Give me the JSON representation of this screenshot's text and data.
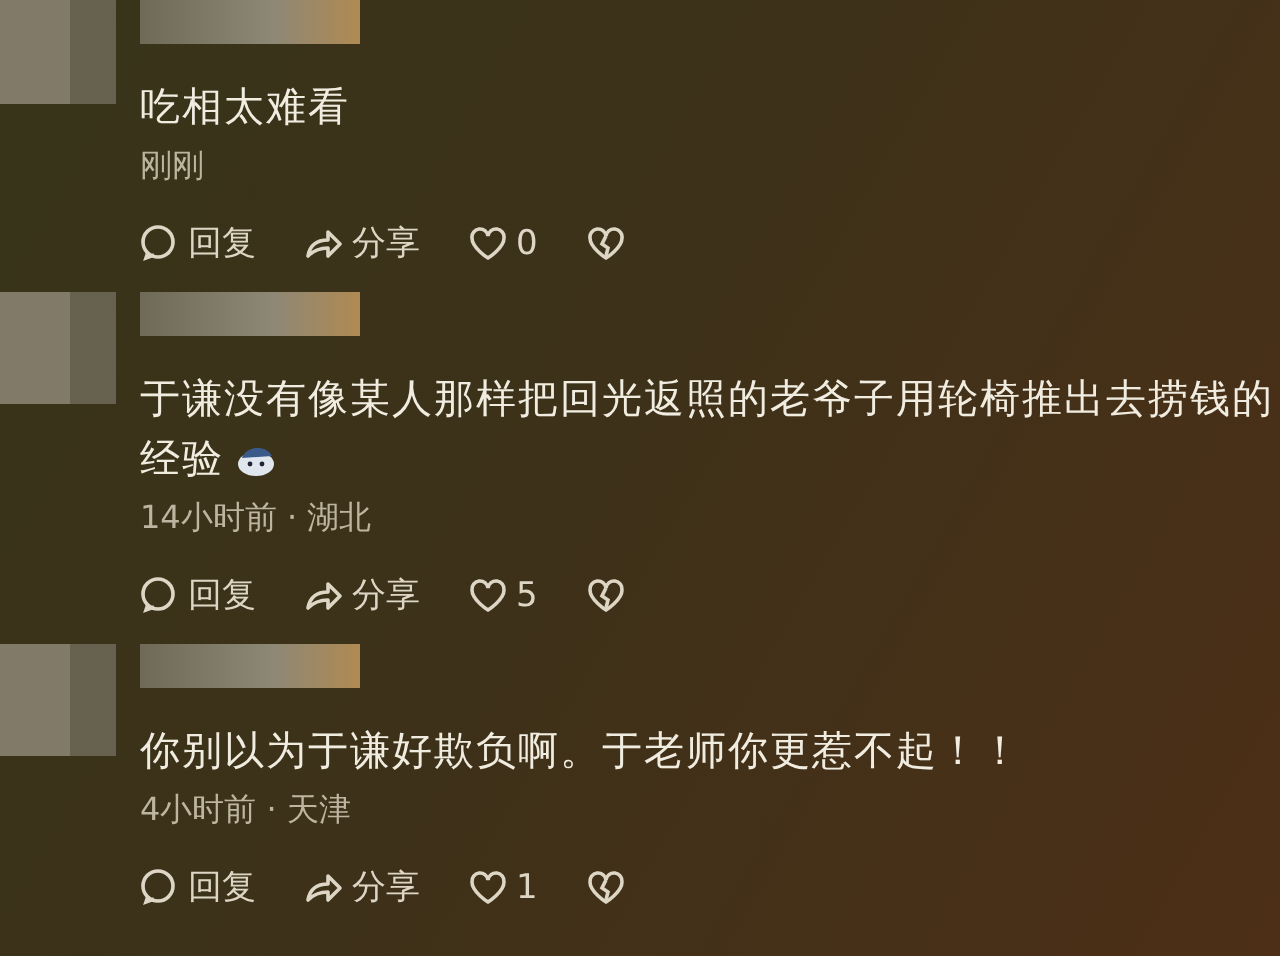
{
  "comments": [
    {
      "text": "吃相太难看",
      "has_sticker": false,
      "meta": "刚刚",
      "actions": {
        "reply": "回复",
        "share": "分享",
        "likes": "0"
      }
    },
    {
      "text": "于谦没有像某人那样把回光返照的老爷子用轮椅推出去捞钱的经验",
      "has_sticker": true,
      "meta": "14小时前 · 湖北",
      "actions": {
        "reply": "回复",
        "share": "分享",
        "likes": "5"
      }
    },
    {
      "text": "你别以为于谦好欺负啊。于老师你更惹不起！！",
      "has_sticker": false,
      "meta": "4小时前 · 天津",
      "actions": {
        "reply": "回复",
        "share": "分享",
        "likes": "1"
      }
    }
  ]
}
